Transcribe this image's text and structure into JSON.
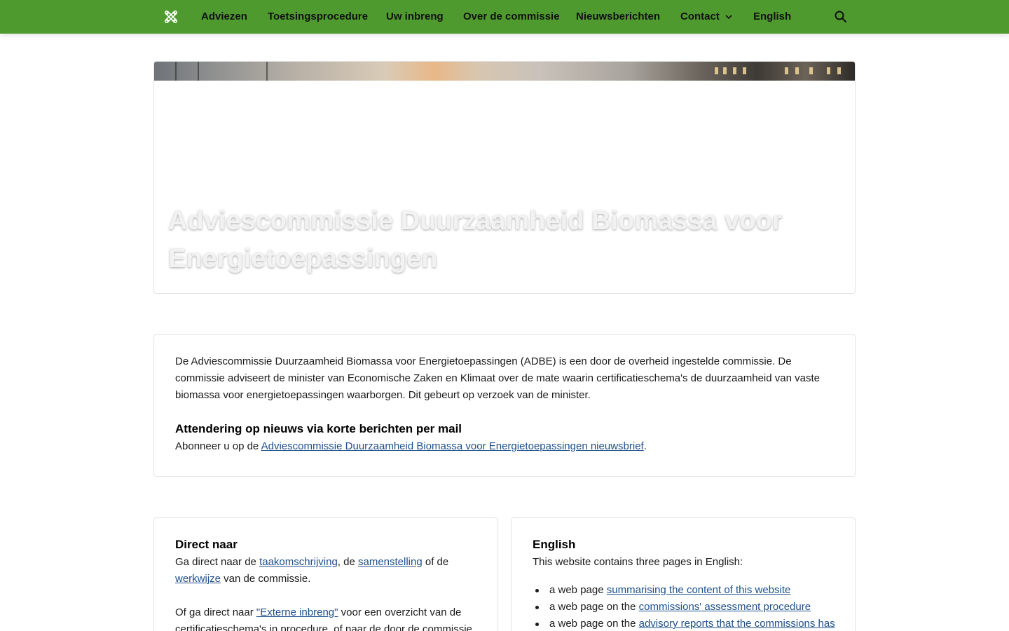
{
  "nav": {
    "logo_icon": "commission-logo-icon",
    "items": [
      {
        "label": "Adviezen"
      },
      {
        "label": "Toetsingsprocedure"
      },
      {
        "label": "Uw inbreng"
      },
      {
        "label": "Over de commissie"
      },
      {
        "label": "Nieuwsberichten"
      },
      {
        "label": "Contact"
      },
      {
        "label": "English"
      }
    ],
    "contact_icon": "chevron-down-icon",
    "search_icon": "search-icon",
    "background_color": "#4f9a2f"
  },
  "hero": {
    "title": "Adviescommissie Duurzaamheid Biomassa voor Energietoepassingen"
  },
  "intro": {
    "paragraph": "De Adviescommissie Duurzaamheid Biomassa voor Energietoepassingen (ADBE) is een door de overheid ingestelde commissie. De commissie adviseert de minister van Economische Zaken en Klimaat over de mate waarin certificatieschema's de duurzaamheid van vaste biomassa voor energietoepassingen waarborgen. Dit gebeurt op verzoek van de minister.",
    "heading": "Attendering op nieuws via korte berichten per mail",
    "subscribe_prefix": "Abonneer u op de ",
    "subscribe_link": "Adviescommissie Duurzaamheid Biomassa voor Energietoepassingen nieuwsbrief",
    "subscribe_suffix": "."
  },
  "direct": {
    "heading": "Direct naar",
    "p1_a": "Ga direct naar de ",
    "link_taak": "taakomschrijving",
    "p1_b": ", de ",
    "link_samenstelling": "samenstelling",
    "p1_c": " of de ",
    "link_werkwijze": "werkwijze",
    "p1_d": " van de commissie.",
    "p2_a": "Of ga direct naar ",
    "link_extern": "\"Externe inbreng\"",
    "p2_b": " voor een overzicht van de certificatieschema's in procedure, of naar de door de commissie"
  },
  "english": {
    "heading": "English",
    "intro": "This website contains three pages in English:",
    "items": [
      {
        "prefix": "a web page ",
        "link": "summarising the content of this website"
      },
      {
        "prefix": "a web page on the ",
        "link": "commissions' assessment procedure"
      },
      {
        "prefix": "a web page on the ",
        "link": "advisory reports that the commissions has"
      }
    ]
  },
  "colors": {
    "link": "#1e4f8a",
    "nav_text": "#111111",
    "card_border": "#e3e3e3"
  }
}
